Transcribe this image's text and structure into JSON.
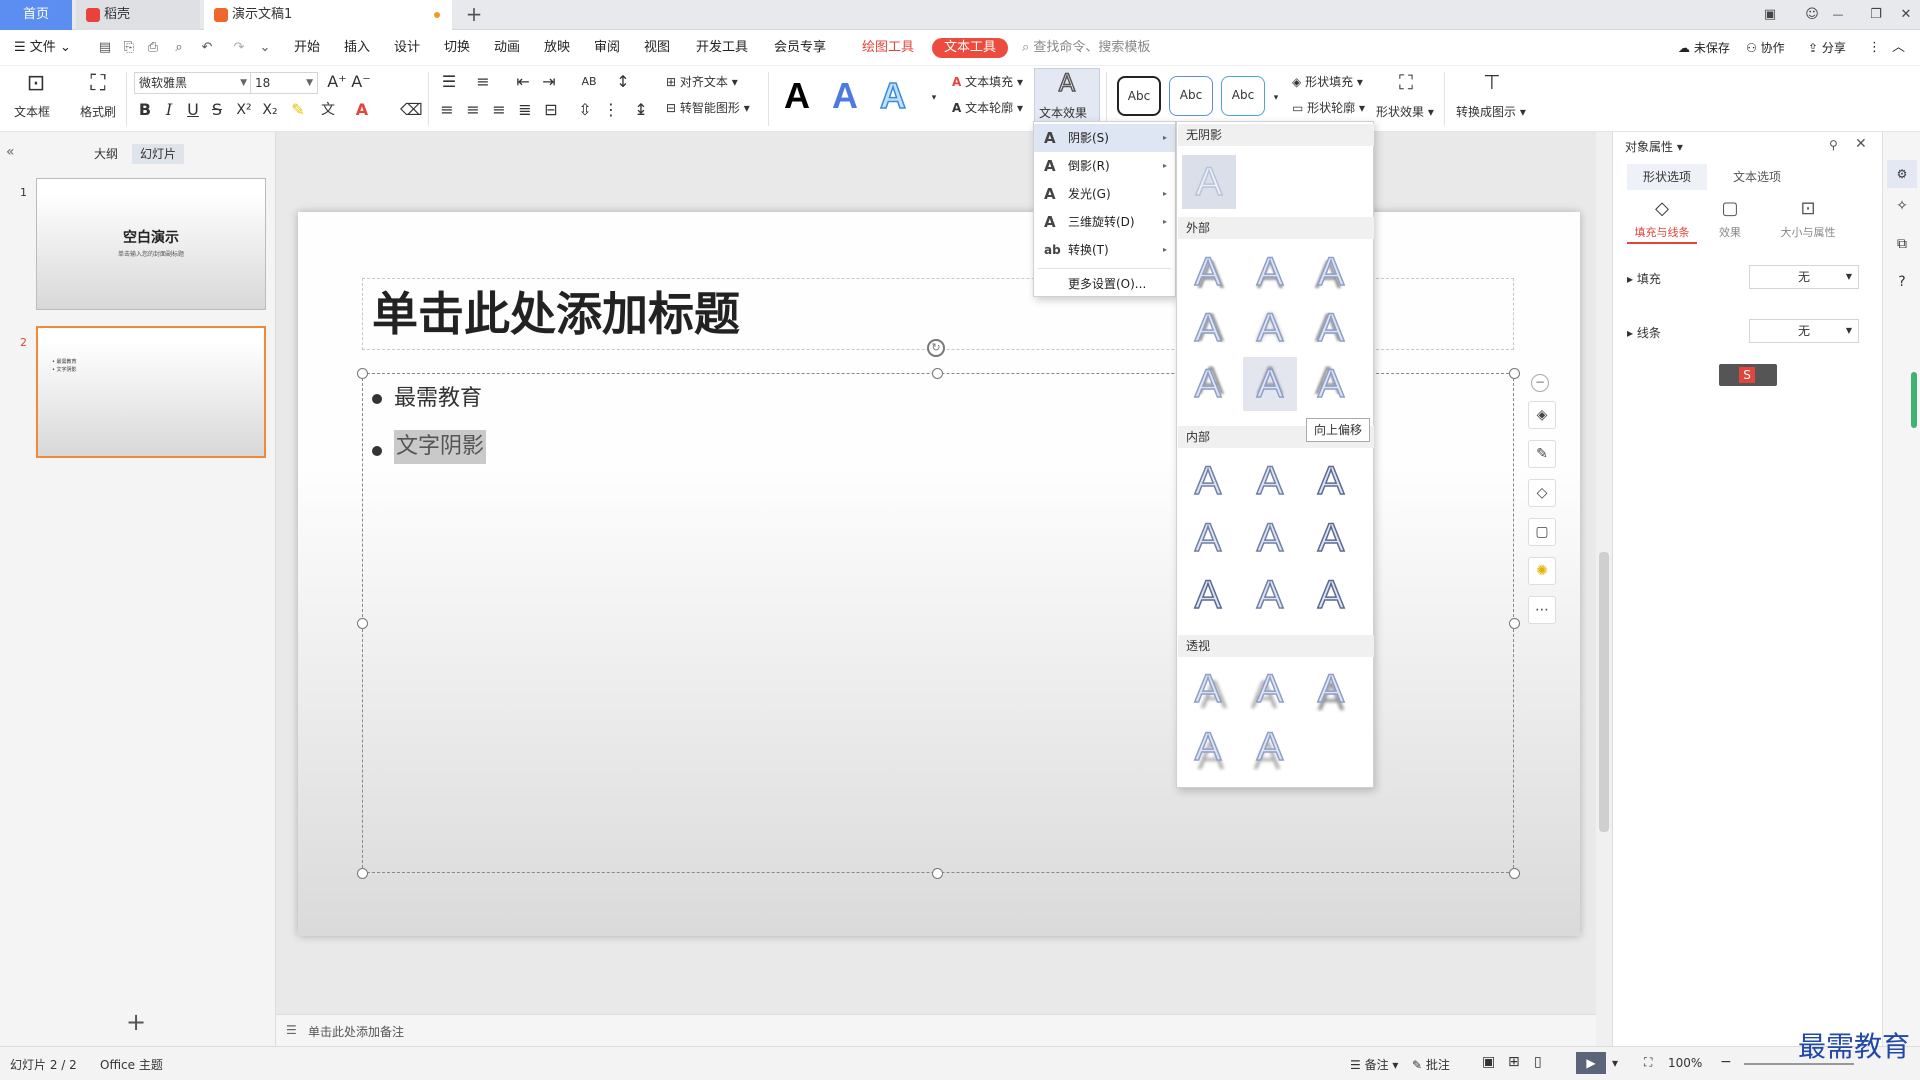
{
  "tabs": {
    "home": "首页",
    "docer": "稻壳",
    "doc": "演示文稿1",
    "add": "+"
  },
  "window": {
    "user_icon": "user-icon",
    "min": "—",
    "restore": "❐",
    "close": "✕"
  },
  "menu": {
    "file": "文件",
    "items": [
      "开始",
      "插入",
      "设计",
      "切换",
      "动画",
      "放映",
      "审阅",
      "视图",
      "开发工具",
      "会员专享"
    ],
    "draw_tools": "绘图工具",
    "text_tools": "文本工具",
    "search": "查找命令、搜索模板",
    "unsaved": "未保存",
    "collab": "协作",
    "share": "分享"
  },
  "ribbon": {
    "textbox": "文本框",
    "format_painter": "格式刷",
    "font": "微软雅黑",
    "size": "18",
    "align_text": "对齐文本",
    "smart_shape": "转智能图形",
    "text_fill": "文本填充",
    "text_outline": "文本轮廓",
    "text_effect": "文本效果",
    "styles": [
      "Abc",
      "Abc",
      "Abc"
    ],
    "shape_fill": "形状填充",
    "shape_outline": "形状轮廓",
    "shape_effect": "形状效果",
    "convert": "转换成图示",
    "bold": "B",
    "italic": "I",
    "underline": "U",
    "strike": "S"
  },
  "left": {
    "outline": "大纲",
    "slides": "幻灯片",
    "thumb1_title": "空白演示",
    "thumb1_sub": "单击输入您的封面副标题",
    "thumb_nums": [
      "1",
      "2"
    ],
    "thumb2_lines": [
      "• 最需教育",
      "• 文字阴影"
    ],
    "add": "+"
  },
  "slide": {
    "title": "单击此处添加标题",
    "bullets": [
      "最需教育",
      "文字阴影"
    ]
  },
  "notes": "单击此处添加备注",
  "effects_menu": {
    "items": [
      {
        "label": "阴影(S)",
        "icon": "A"
      },
      {
        "label": "倒影(R)",
        "icon": "A"
      },
      {
        "label": "发光(G)",
        "icon": "A"
      },
      {
        "label": "三维旋转(D)",
        "icon": "A"
      },
      {
        "label": "转换(T)",
        "icon": "ab"
      }
    ],
    "more": "更多设置(O)..."
  },
  "gallery": {
    "none": "无阴影",
    "outer": "外部",
    "inner": "内部",
    "perspective": "透视",
    "tooltip": "向上偏移",
    "glyph": "A"
  },
  "panel": {
    "title": "对象属性",
    "tab_shape": "形状选项",
    "tab_text": "文本选项",
    "sub_fill_line": "填充与线条",
    "sub_effect": "效果",
    "sub_size": "大小与属性",
    "fill": "填充",
    "line": "线条",
    "fill_value": "无",
    "line_value": "无"
  },
  "status": {
    "slide": "幻灯片 2 / 2",
    "theme": "Office 主题",
    "notes": "备注",
    "comments": "批注",
    "zoom": "100%"
  },
  "watermark": "最需教育",
  "colors": {
    "accent": "#5b8ef0",
    "text_tool": "#ec4b3d",
    "selection": "#f08a3a"
  }
}
